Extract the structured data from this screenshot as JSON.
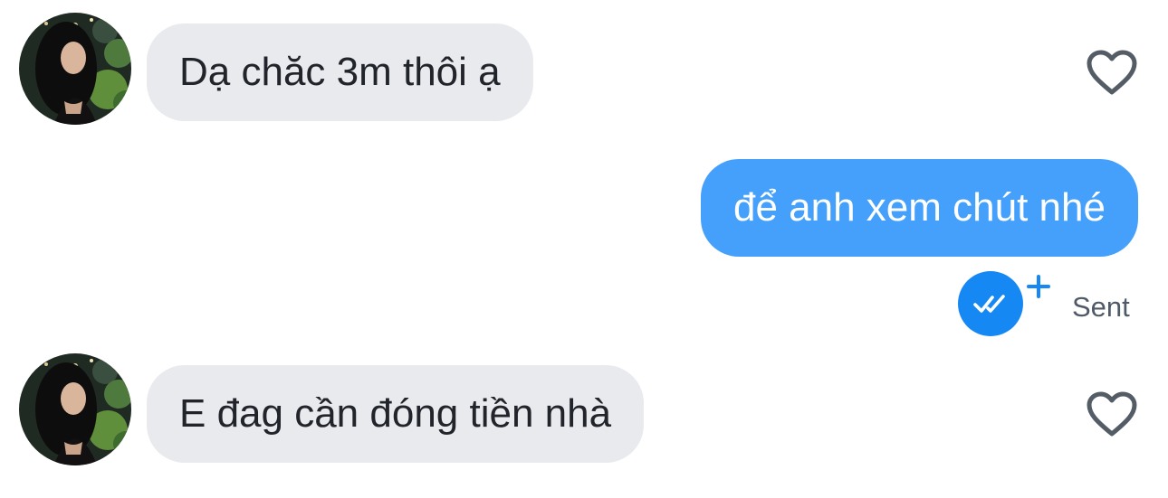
{
  "messages": [
    {
      "direction": "incoming",
      "text": "Dạ chăc 3m thôi ạ",
      "liked": false
    },
    {
      "direction": "outgoing",
      "text": "để anh xem chút nhé",
      "status": "Sent"
    },
    {
      "direction": "incoming",
      "text": "E đag cần đóng tiền nhà",
      "liked": false
    }
  ],
  "icons": {
    "like": "heart-outline-icon",
    "read": "double-check-icon",
    "add": "plus-icon"
  },
  "colors": {
    "incoming_bubble": "#e9eaee",
    "outgoing_bubble": "#44a0fb",
    "read_badge": "#1688f4",
    "heart_stroke": "#545c66",
    "status_text": "#505a66"
  }
}
